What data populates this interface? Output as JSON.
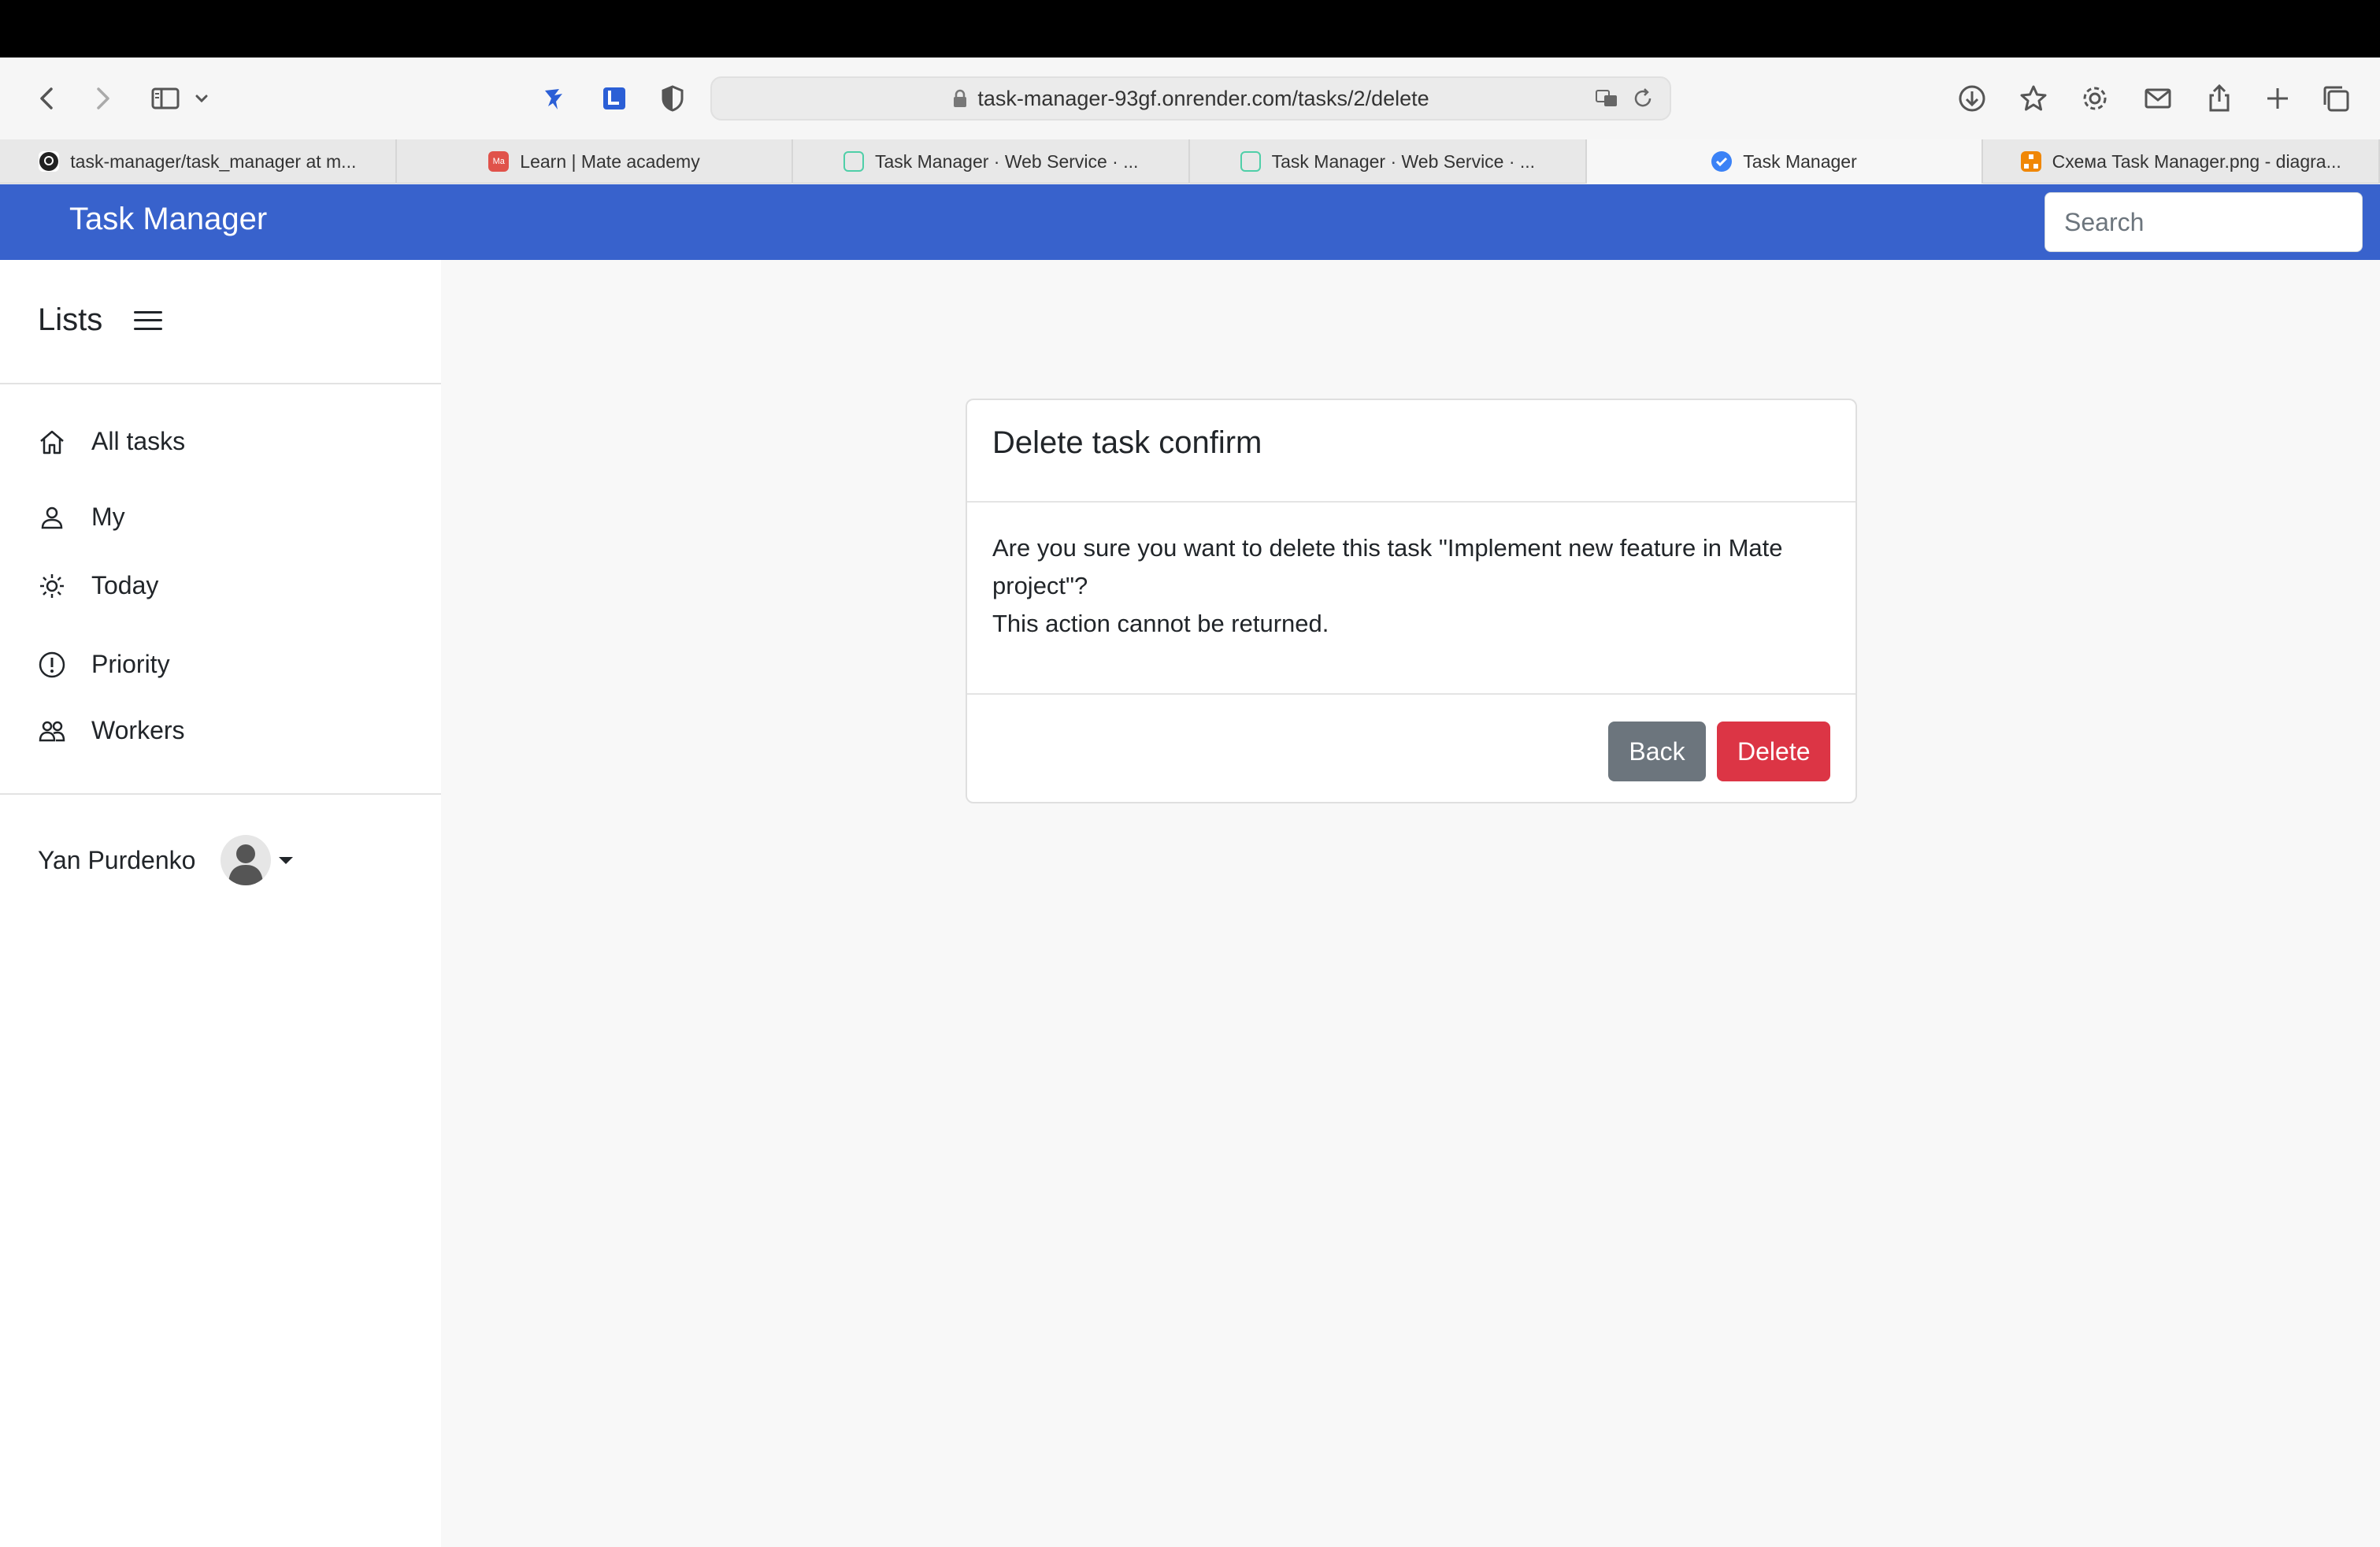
{
  "browser": {
    "url": "task-manager-93gf.onrender.com/tasks/2/delete",
    "tabs": [
      {
        "label": "task-manager/task_manager at m...",
        "icon": "github-icon",
        "active": false
      },
      {
        "label": "Learn | Mate academy",
        "icon": "mate-academy-icon",
        "active": false
      },
      {
        "label": "Task Manager  ·  Web Service  ·  ...",
        "icon": "render-icon",
        "active": false
      },
      {
        "label": "Task Manager  ·  Web Service  ·  ...",
        "icon": "render-icon",
        "active": false
      },
      {
        "label": "Task Manager",
        "icon": "check-circle-icon",
        "active": true
      },
      {
        "label": "Схема Task Manager.png - diagra...",
        "icon": "diagrams-icon",
        "active": false
      }
    ]
  },
  "navbar": {
    "brand": "Task Manager",
    "search_placeholder": "Search",
    "color": "#3862cc"
  },
  "sidebar": {
    "title": "Lists",
    "items": [
      {
        "label": "All tasks",
        "icon": "home-icon"
      },
      {
        "label": "My",
        "icon": "person-icon"
      },
      {
        "label": "Today",
        "icon": "sun-icon"
      },
      {
        "label": "Priority",
        "icon": "exclamation-circle-icon"
      },
      {
        "label": "Workers",
        "icon": "people-icon"
      }
    ],
    "user_name": "Yan Purdenko"
  },
  "dialog": {
    "title": "Delete task confirm",
    "line1": "Are you sure you want to delete this task \"Implement new feature in Mate",
    "line2": "project\"?",
    "line3": "This action cannot be returned.",
    "back_label": "Back",
    "delete_label": "Delete",
    "back_color": "#6c757d",
    "delete_color": "#dc3545"
  }
}
